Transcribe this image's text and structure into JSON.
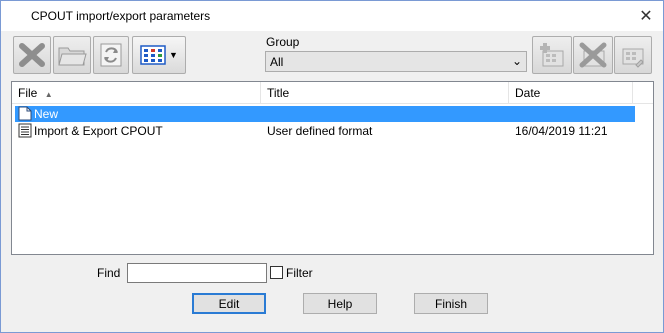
{
  "window": {
    "title": "CPOUT import/export parameters"
  },
  "toolbar": {
    "group_label": "Group",
    "group_value": "All"
  },
  "list": {
    "headers": {
      "file": "File",
      "title": "Title",
      "date": "Date"
    },
    "rows": [
      {
        "file": "New",
        "title": "",
        "date": "",
        "selected": true
      },
      {
        "file": "Import & Export CPOUT",
        "title": "User defined format",
        "date": "16/04/2019  11:21",
        "selected": false
      }
    ]
  },
  "find": {
    "label": "Find",
    "value": "",
    "filter_label": "Filter",
    "filter_checked": false
  },
  "buttons": {
    "edit": "Edit",
    "help": "Help",
    "finish": "Finish"
  },
  "colors": {
    "selection": "#3399ff",
    "window_bg": "#f0f0f0",
    "default_button_border": "#2a7bd4"
  }
}
